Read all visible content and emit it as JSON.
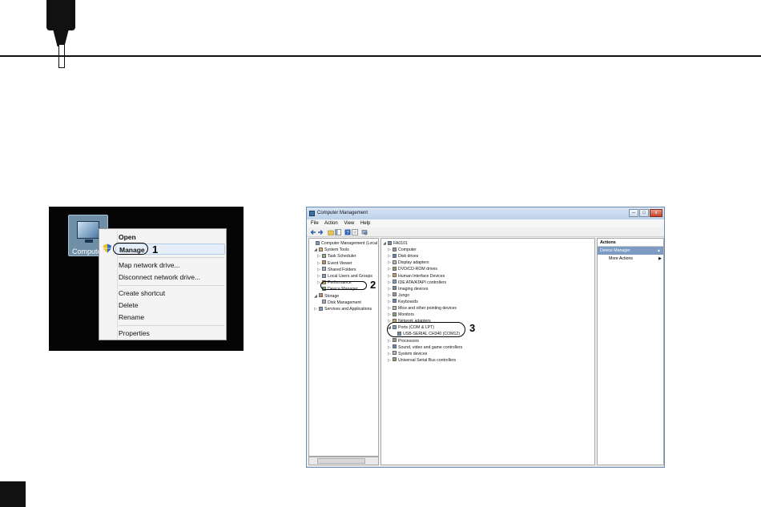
{
  "context_menu_shot": {
    "desktop_icon_label": "Computer",
    "items": [
      {
        "label": "Open"
      },
      {
        "label": "Manage"
      },
      {
        "label": "Map network drive..."
      },
      {
        "label": "Disconnect network drive..."
      },
      {
        "label": "Create shortcut"
      },
      {
        "label": "Delete"
      },
      {
        "label": "Rename"
      },
      {
        "label": "Properties"
      }
    ],
    "callout": "1"
  },
  "computer_management": {
    "title": "Computer Management",
    "window_buttons": [
      "–",
      "□",
      "x"
    ],
    "menu": [
      "File",
      "Action",
      "View",
      "Help"
    ],
    "left_tree": [
      {
        "label": "Computer Management (Local",
        "exp": "",
        "indent": 0
      },
      {
        "label": "System Tools",
        "exp": "◢",
        "indent": 1
      },
      {
        "label": "Task Scheduler",
        "exp": "▷",
        "indent": 2
      },
      {
        "label": "Event Viewer",
        "exp": "▷",
        "indent": 2
      },
      {
        "label": "Shared Folders",
        "exp": "▷",
        "indent": 2
      },
      {
        "label": "Local Users and Groups",
        "exp": "▷",
        "indent": 2
      },
      {
        "label": "Performance",
        "exp": "▷",
        "indent": 2
      },
      {
        "label": "Device Manager",
        "exp": "",
        "indent": 2
      },
      {
        "label": "Storage",
        "exp": "◢",
        "indent": 1
      },
      {
        "label": "Disk Management",
        "exp": "",
        "indent": 2
      },
      {
        "label": "Services and Applications",
        "exp": "▷",
        "indent": 1
      }
    ],
    "device_tree": [
      {
        "label": "FA0101",
        "exp": "◢",
        "indent": 0
      },
      {
        "label": "Computer",
        "exp": "▷",
        "indent": 1
      },
      {
        "label": "Disk drives",
        "exp": "▷",
        "indent": 1
      },
      {
        "label": "Display adapters",
        "exp": "▷",
        "indent": 1
      },
      {
        "label": "DVD/CD-ROM drives",
        "exp": "▷",
        "indent": 1
      },
      {
        "label": "Human Interface Devices",
        "exp": "▷",
        "indent": 1
      },
      {
        "label": "IDE ATA/ATAPI controllers",
        "exp": "▷",
        "indent": 1
      },
      {
        "label": "Imaging devices",
        "exp": "▷",
        "indent": 1
      },
      {
        "label": "Jungo",
        "exp": "▷",
        "indent": 1
      },
      {
        "label": "Keyboards",
        "exp": "▷",
        "indent": 1
      },
      {
        "label": "Mice and other pointing devices",
        "exp": "▷",
        "indent": 1
      },
      {
        "label": "Monitors",
        "exp": "▷",
        "indent": 1
      },
      {
        "label": "Network adapters",
        "exp": "▷",
        "indent": 1
      },
      {
        "label": "Ports (COM & LPT)",
        "exp": "◢",
        "indent": 1
      },
      {
        "label": "USB-SERIAL CH340 (COM12)",
        "exp": "",
        "indent": 2
      },
      {
        "label": "Processors",
        "exp": "▷",
        "indent": 1
      },
      {
        "label": "Sound, video and game controllers",
        "exp": "▷",
        "indent": 1
      },
      {
        "label": "System devices",
        "exp": "▷",
        "indent": 1
      },
      {
        "label": "Universal Serial Bus controllers",
        "exp": "▷",
        "indent": 1
      }
    ],
    "actions": {
      "header": "Actions",
      "selected": "Device Manager",
      "more": "More Actions"
    },
    "callouts": [
      "2",
      "3"
    ]
  }
}
